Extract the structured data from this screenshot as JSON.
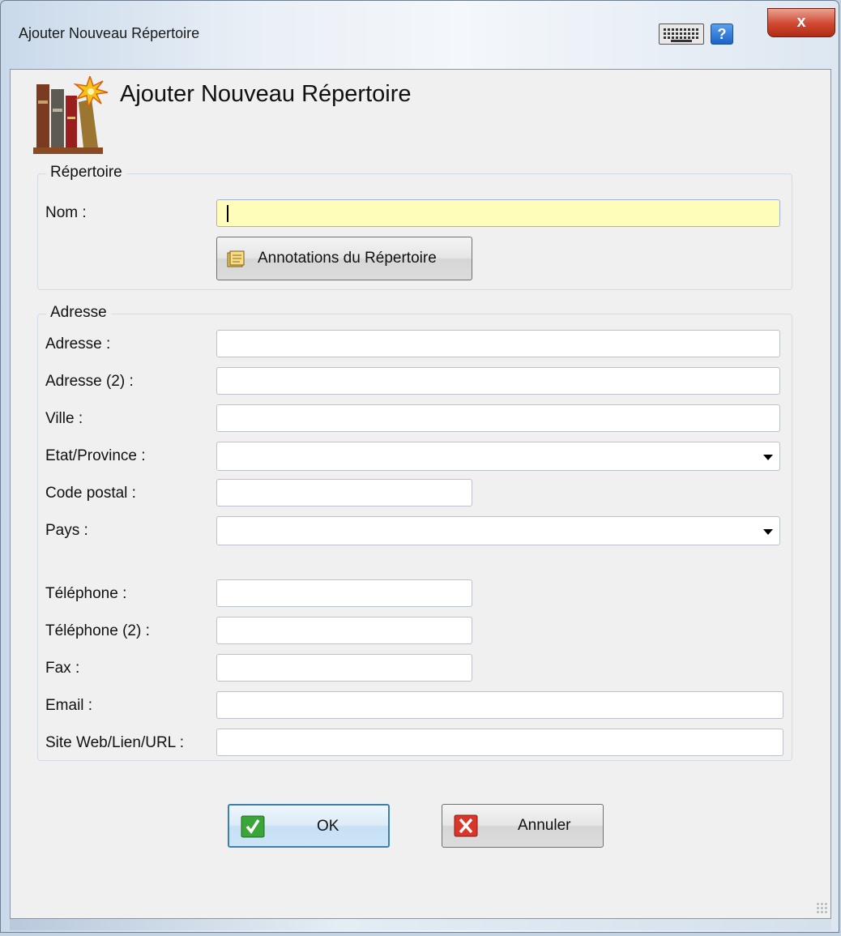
{
  "window": {
    "title": "Ajouter Nouveau Répertoire",
    "close_glyph": "x",
    "help_glyph": "?"
  },
  "icons": {
    "header": "books-icon",
    "keyboard": "keyboard-icon",
    "help": "help-icon",
    "notes": "notebook-icon",
    "ok": "checkmark-icon",
    "cancel": "cross-icon"
  },
  "header": {
    "title": "Ajouter Nouveau Répertoire"
  },
  "repertoire_group": {
    "legend": "Répertoire",
    "name_label": "Nom :",
    "name_value": "",
    "annotations_button": "Annotations du Répertoire"
  },
  "address_group": {
    "legend": "Adresse",
    "fields": {
      "address": {
        "label": "Adresse :",
        "value": ""
      },
      "address2": {
        "label": "Adresse (2) :",
        "value": ""
      },
      "city": {
        "label": "Ville :",
        "value": ""
      },
      "state": {
        "label": "Etat/Province :",
        "value": ""
      },
      "postal": {
        "label": "Code postal :",
        "value": ""
      },
      "country": {
        "label": "Pays :",
        "value": ""
      },
      "phone": {
        "label": "Téléphone :",
        "value": ""
      },
      "phone2": {
        "label": "Téléphone (2) :",
        "value": ""
      },
      "fax": {
        "label": "Fax :",
        "value": ""
      },
      "email": {
        "label": "Email :",
        "value": ""
      },
      "website": {
        "label": "Site Web/Lien/URL :",
        "value": ""
      }
    }
  },
  "buttons": {
    "ok": "OK",
    "cancel": "Annuler"
  },
  "colors": {
    "name_field_bg": "#fffdb9",
    "close_button": "#c9432d",
    "ok_check": "#3aa63a",
    "cancel_cross": "#d9352a"
  }
}
